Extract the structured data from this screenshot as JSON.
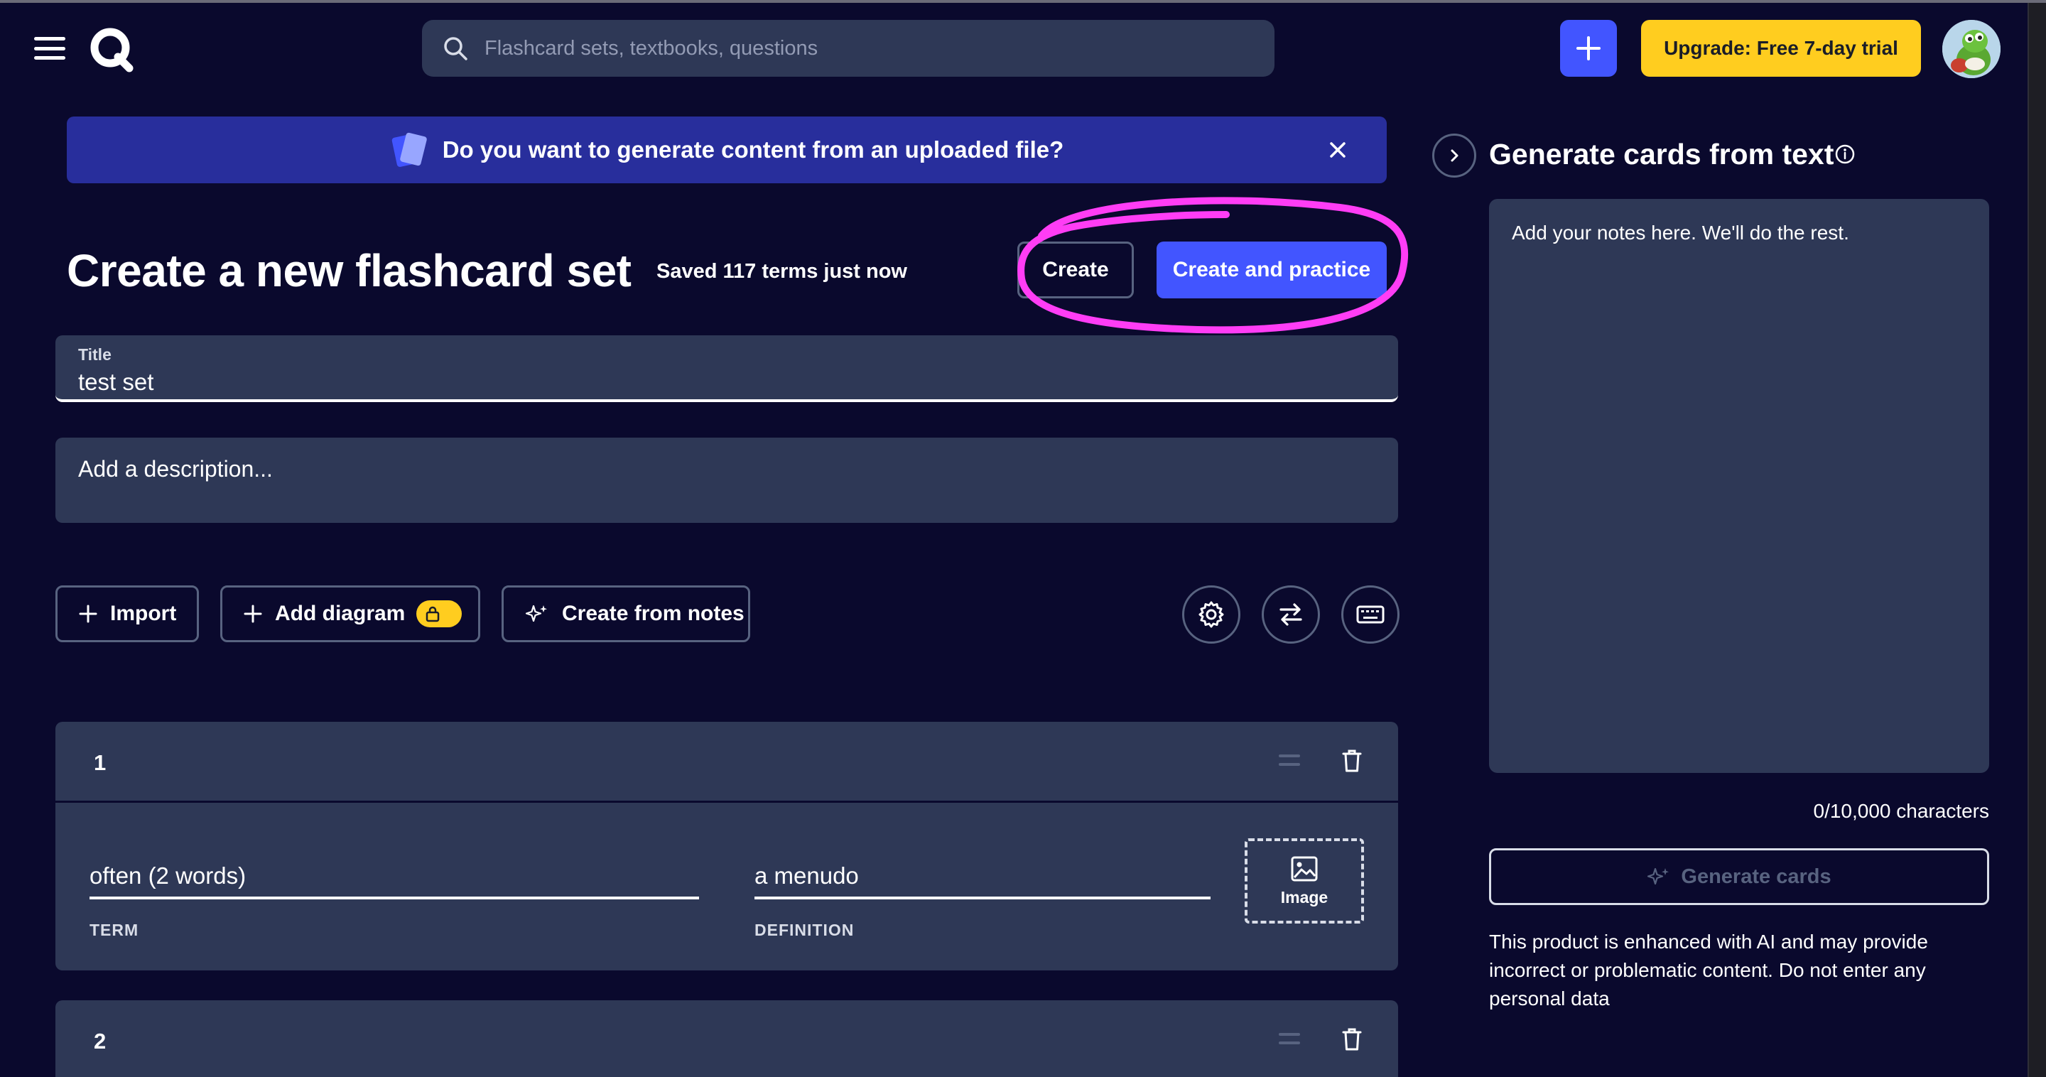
{
  "nav": {
    "search_placeholder": "Flashcard sets, textbooks, questions",
    "upgrade_label": "Upgrade: Free 7-day trial"
  },
  "banner": {
    "text": "Do you want to generate content from an uploaded file?"
  },
  "header": {
    "title": "Create a new flashcard set",
    "saved_status": "Saved 117 terms just now",
    "create_label": "Create",
    "create_practice_label": "Create and practice"
  },
  "form": {
    "title_label": "Title",
    "title_value": "test set",
    "description_placeholder": "Add a description..."
  },
  "tools": {
    "import_label": "Import",
    "add_diagram_label": "Add diagram",
    "create_from_notes_label": "Create from notes"
  },
  "cards": [
    {
      "number": "1",
      "term": "often (2 words)",
      "definition": "a menudo",
      "term_label": "TERM",
      "definition_label": "DEFINITION",
      "image_label": "Image"
    },
    {
      "number": "2"
    }
  ],
  "panel": {
    "title": "Generate cards from text",
    "notes_placeholder": "Add your notes here. We'll do the rest.",
    "char_count": "0/10,000 characters",
    "generate_label": "Generate cards",
    "disclaimer": "This product is enhanced with AI and may provide incorrect or problematic content. Do not enter any personal data"
  },
  "colors": {
    "background": "#0a092d",
    "surface": "#2e3856",
    "primary": "#4255ff",
    "upgrade": "#ffcd1f",
    "banner": "#282e9c",
    "annotation_highlight": "#ff3df5"
  }
}
